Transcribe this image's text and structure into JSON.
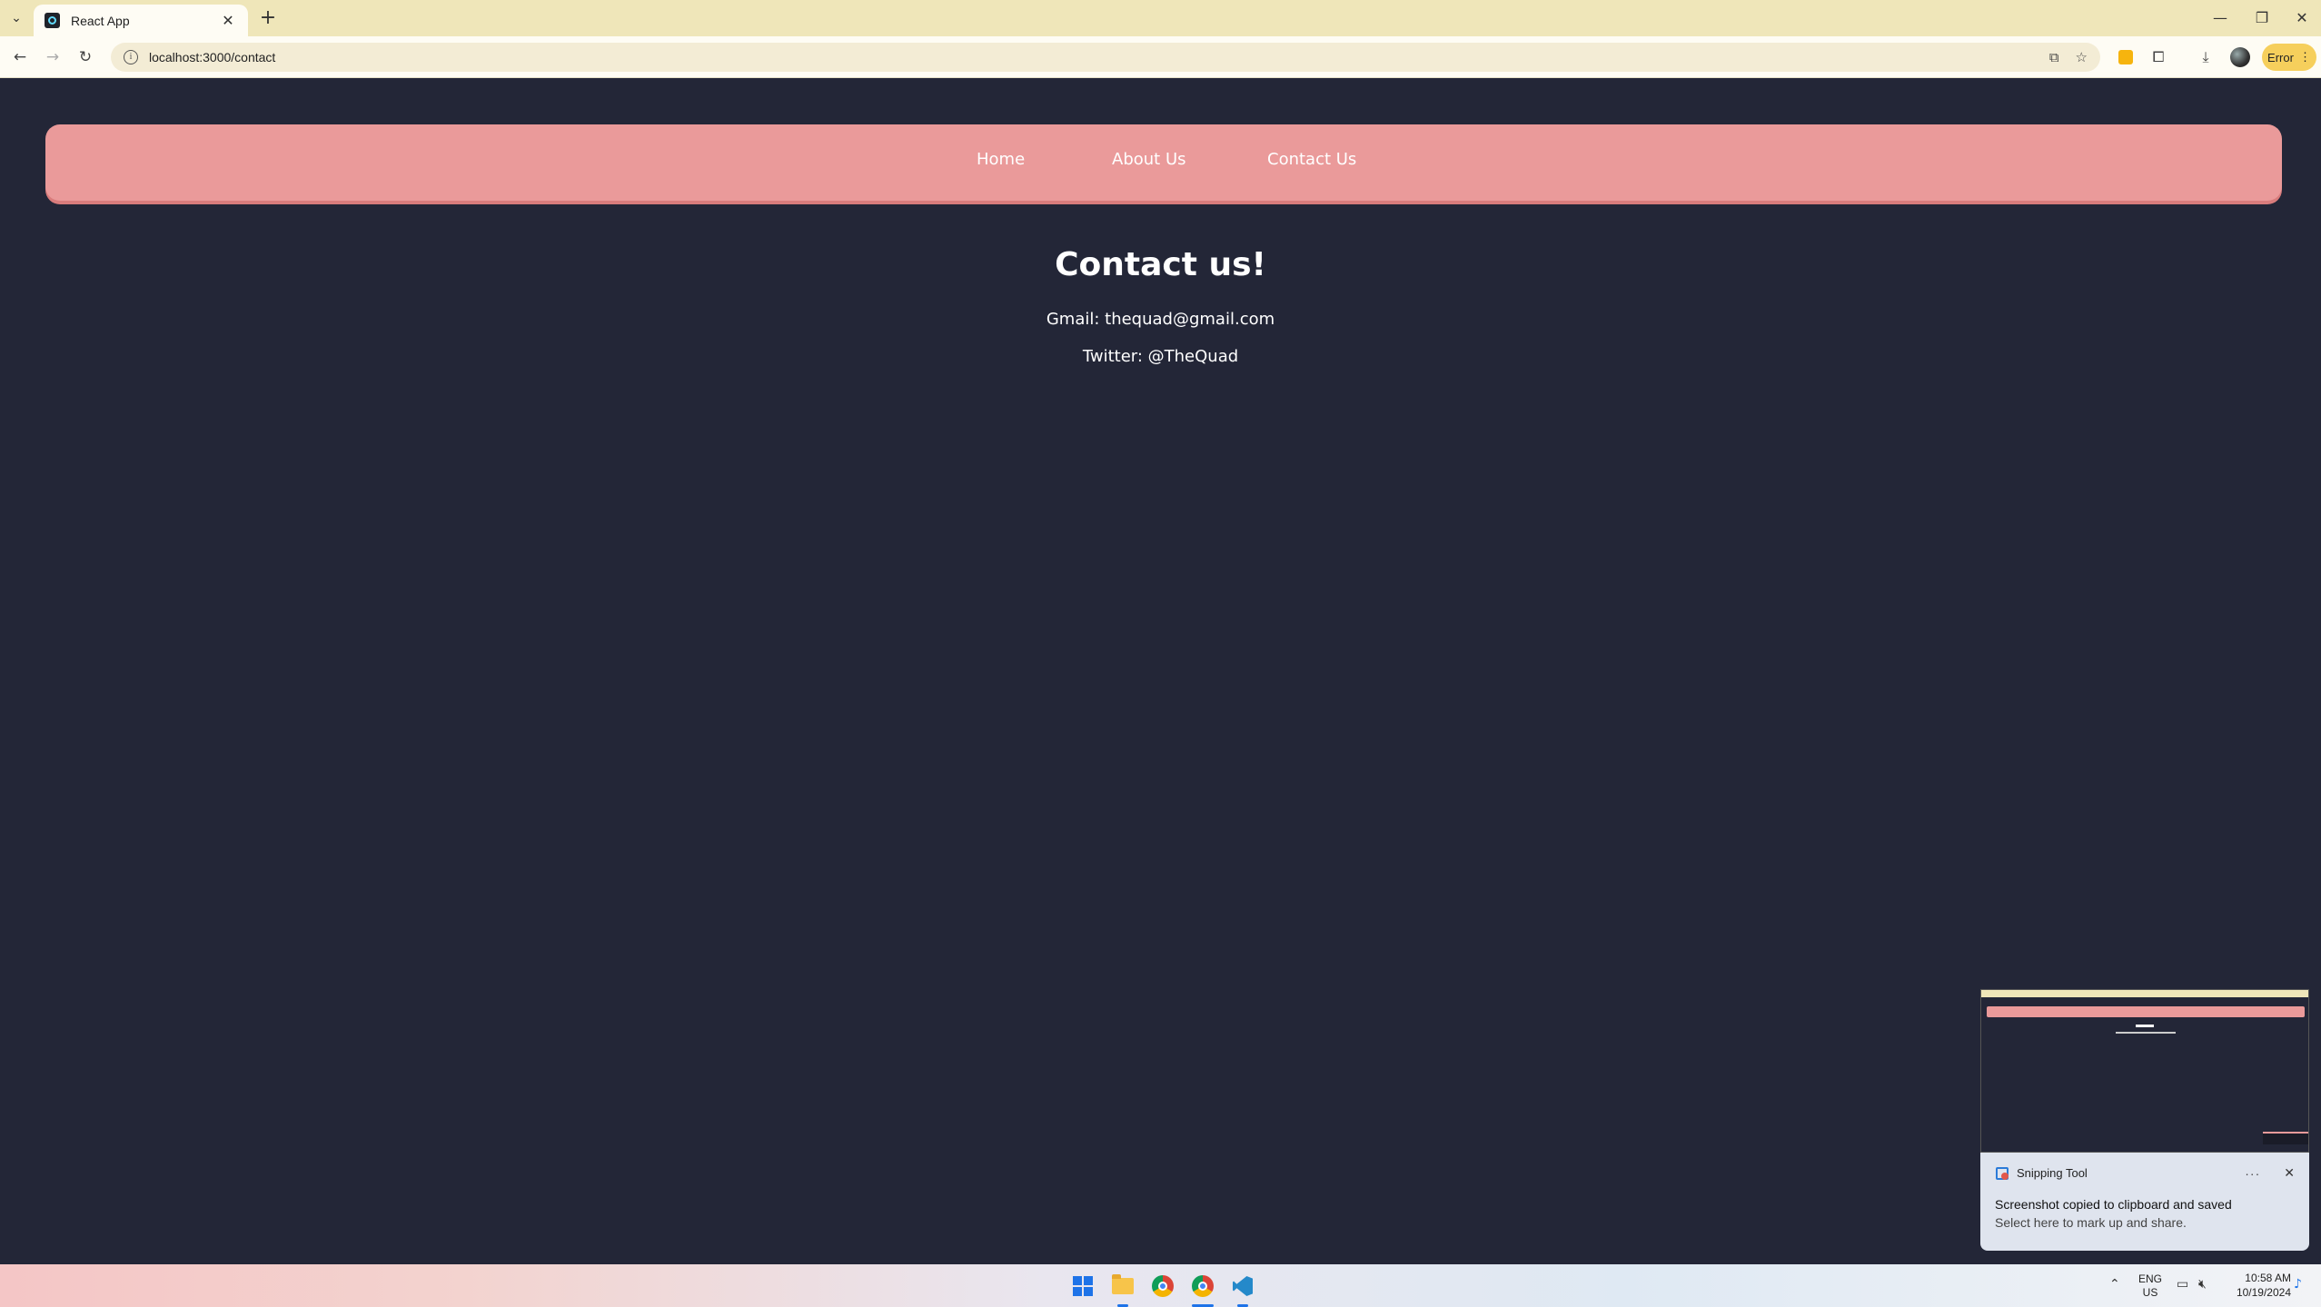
{
  "browser": {
    "tab_title": "React App",
    "url": "localhost:3000/contact",
    "error_label": "Error"
  },
  "page": {
    "nav": {
      "links": [
        "Home",
        "About Us",
        "Contact Us"
      ]
    },
    "heading": "Contact us!",
    "gmail": "Gmail: thequad@gmail.com",
    "twitter": "Twitter: @TheQuad",
    "colors": {
      "background": "#232637",
      "navbar": "#ea9a9a",
      "text": "#ffffff"
    }
  },
  "toast": {
    "app_name": "Snipping Tool",
    "title": "Screenshot copied to clipboard and saved",
    "body": "Select here to mark up and share."
  },
  "taskbar": {
    "lang_top": "ENG",
    "lang_bottom": "US",
    "time": "10:58 AM",
    "date": "10/19/2024"
  }
}
